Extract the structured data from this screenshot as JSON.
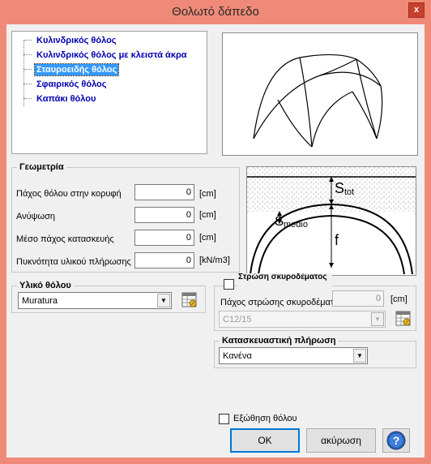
{
  "window": {
    "title": "Θολωτό δάπεδο",
    "close_label": "x"
  },
  "tree": {
    "items": [
      {
        "label": "Κυλινδρικός θόλος",
        "selected": false
      },
      {
        "label": "Κυλινδρικός θόλος με κλειστά άκρα",
        "selected": false
      },
      {
        "label": "Σταυροειδής θόλος",
        "selected": true
      },
      {
        "label": "Σφαιρικός θόλος",
        "selected": false
      },
      {
        "label": "Καπάκι θόλου",
        "selected": false
      }
    ]
  },
  "geometry": {
    "title": "Γεωμετρία",
    "fields": [
      {
        "label": "Πάχος θόλου στην κορυφή",
        "value": "0",
        "unit": "[cm]"
      },
      {
        "label": "Ανύψωση",
        "value": "0",
        "unit": "[cm]"
      },
      {
        "label": "Μέσο πάχος κατασκευής",
        "value": "0",
        "unit": "[cm]"
      },
      {
        "label": "Πυκνότητα υλικού πλήρωσης",
        "value": "0",
        "unit": "[kN/m3]"
      }
    ]
  },
  "diagram": {
    "s_tot": "S",
    "s_tot_sub": "tot",
    "s_medio": "S",
    "s_medio_sub": "medio",
    "f": "f"
  },
  "material": {
    "title": "Υλικό θόλου",
    "selected": "Muratura"
  },
  "concrete": {
    "checkbox_label": "Στρώση σκυροδέματος",
    "checked": false,
    "thickness_label": "Πάχος στρώσης σκυροδέματ",
    "thickness_value": "0",
    "thickness_unit": "[cm]",
    "class_selected": "C12/15"
  },
  "fill": {
    "title": "Κατασκευαστική πλήρωση",
    "selected": "Κανένα"
  },
  "thrust": {
    "label": "Εξώθηση θόλου",
    "checked": false
  },
  "buttons": {
    "ok": "OK",
    "cancel": "ακύρωση",
    "help": "?"
  }
}
